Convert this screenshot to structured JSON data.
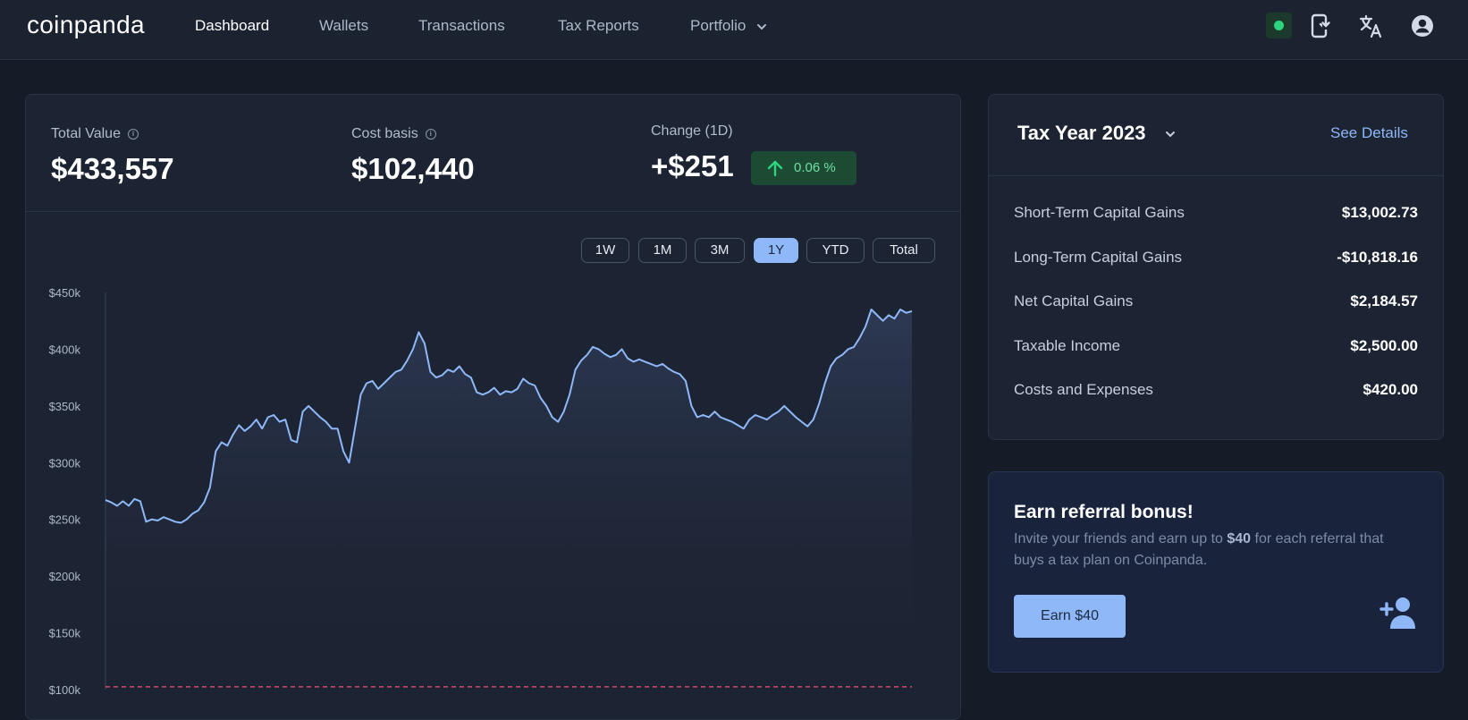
{
  "app": {
    "logo": "coinpanda"
  },
  "nav": {
    "dashboard": "Dashboard",
    "wallets": "Wallets",
    "transactions": "Transactions",
    "tax_reports": "Tax Reports",
    "portfolio": "Portfolio"
  },
  "topbar_icons": [
    "status-indicator",
    "mobile-download-icon",
    "translate-icon",
    "user-account-icon"
  ],
  "stats": {
    "total_value_label": "Total Value",
    "total_value": "$433,557",
    "cost_basis_label": "Cost basis",
    "cost_basis": "$102,440",
    "change_label": "Change (1D)",
    "change_value": "+$251",
    "change_pct": "0.06 %"
  },
  "timeframes": [
    "1W",
    "1M",
    "3M",
    "1Y",
    "YTD",
    "Total"
  ],
  "active_timeframe": "1Y",
  "chart_data": {
    "type": "area",
    "title": "",
    "xlabel": "",
    "ylabel": "",
    "ylim": [
      100000,
      450000
    ],
    "yticks": [
      "$100k",
      "$150k",
      "$200k",
      "$250k",
      "$300k",
      "$350k",
      "$400k",
      "$450k"
    ],
    "grid": false,
    "series": [
      {
        "values": [
          267000,
          265000,
          262000,
          266000,
          262000,
          268000,
          266000,
          248000,
          250000,
          249000,
          252000,
          250000,
          248000,
          247000,
          250000,
          255000,
          258000,
          265000,
          278000,
          310000,
          318000,
          315000,
          325000,
          333000,
          328000,
          332000,
          338000,
          330000,
          340000,
          342000,
          336000,
          338000,
          320000,
          318000,
          345000,
          350000,
          345000,
          340000,
          336000,
          330000,
          330000,
          310000,
          300000,
          330000,
          360000,
          370000,
          372000,
          365000,
          370000,
          375000,
          380000,
          382000,
          390000,
          400000,
          415000,
          405000,
          380000,
          375000,
          377000,
          382000,
          380000,
          385000,
          378000,
          375000,
          362000,
          360000,
          362000,
          366000,
          360000,
          363000,
          362000,
          365000,
          374000,
          370000,
          368000,
          357000,
          350000,
          340000,
          336000,
          345000,
          360000,
          382000,
          390000,
          395000,
          402000,
          400000,
          396000,
          393000,
          395000,
          400000,
          392000,
          389000,
          391000,
          389000,
          387000,
          385000,
          387000,
          383000,
          380000,
          378000,
          372000,
          350000,
          340000,
          342000,
          340000,
          345000,
          340000,
          338000,
          336000,
          333000,
          330000,
          338000,
          342000,
          340000,
          338000,
          342000,
          345000,
          350000,
          345000,
          340000,
          336000,
          332000,
          338000,
          352000,
          370000,
          385000,
          392000,
          395000,
          400000,
          402000,
          410000,
          420000,
          435000,
          430000,
          425000,
          430000,
          427000,
          435000,
          432000,
          433557
        ]
      }
    ],
    "cost_basis_line": 102440
  },
  "tax": {
    "title": "Tax Year 2023",
    "see_details": "See Details",
    "rows": [
      {
        "label": "Short-Term Capital Gains",
        "value": "$13,002.73"
      },
      {
        "label": "Long-Term Capital Gains",
        "value": "-$10,818.16"
      },
      {
        "label": "Net Capital Gains",
        "value": "$2,184.57"
      },
      {
        "label": "Taxable Income",
        "value": "$2,500.00"
      },
      {
        "label": "Costs and Expenses",
        "value": "$420.00"
      }
    ]
  },
  "referral": {
    "title": "Earn referral bonus!",
    "desc_before": "Invite your friends and earn up to ",
    "desc_amount": "$40",
    "desc_after": " for each referral that buys a tax plan on Coinpanda.",
    "button": "Earn $40"
  },
  "colors": {
    "background": "#151b27",
    "card": "#1c2332",
    "accent": "#8fb8f8",
    "positive": "#2bd47d",
    "cost_basis_line": "#d14b6a"
  }
}
